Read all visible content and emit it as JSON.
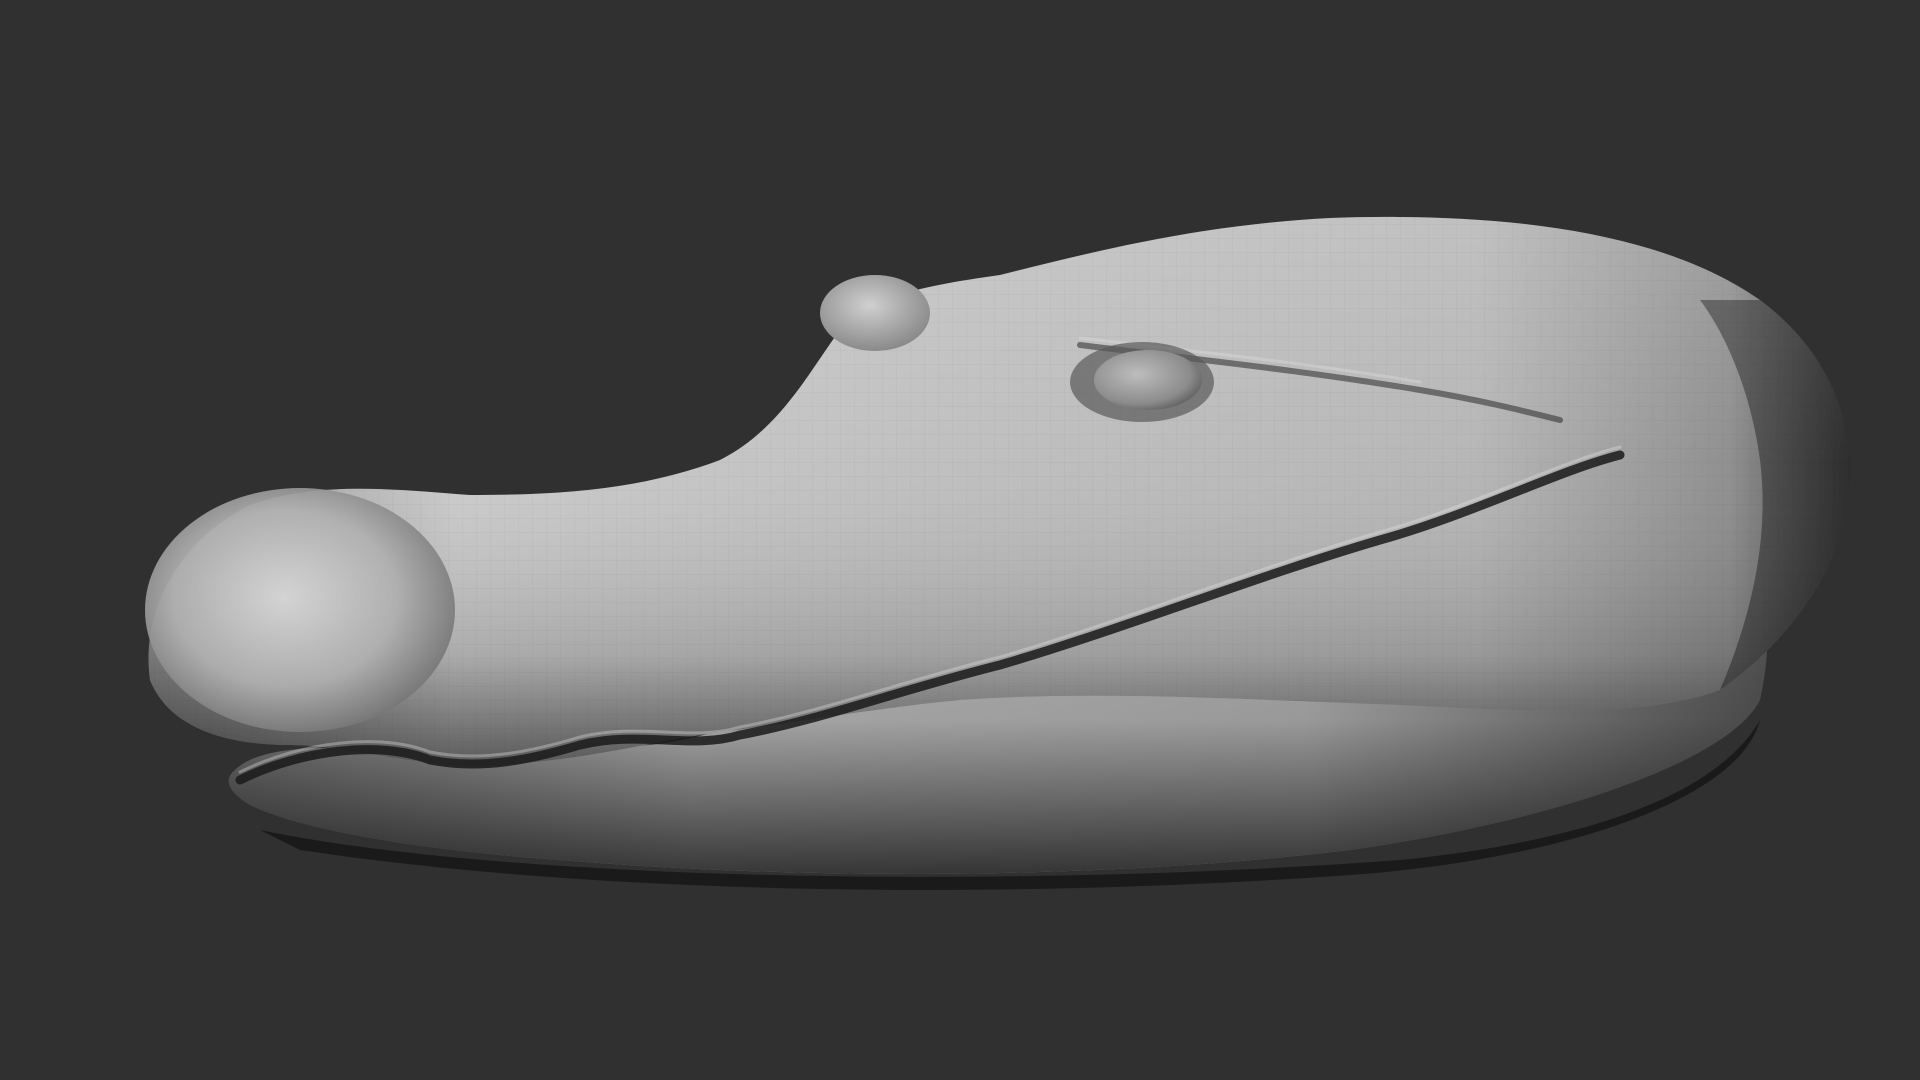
{
  "viewport": {
    "background_color": "#303030",
    "model": {
      "subject": "alligator-head-sculpt",
      "material_color": "#b8b8b8",
      "shadow_color": "#111111",
      "highlight_color": "#eeeeee"
    }
  }
}
